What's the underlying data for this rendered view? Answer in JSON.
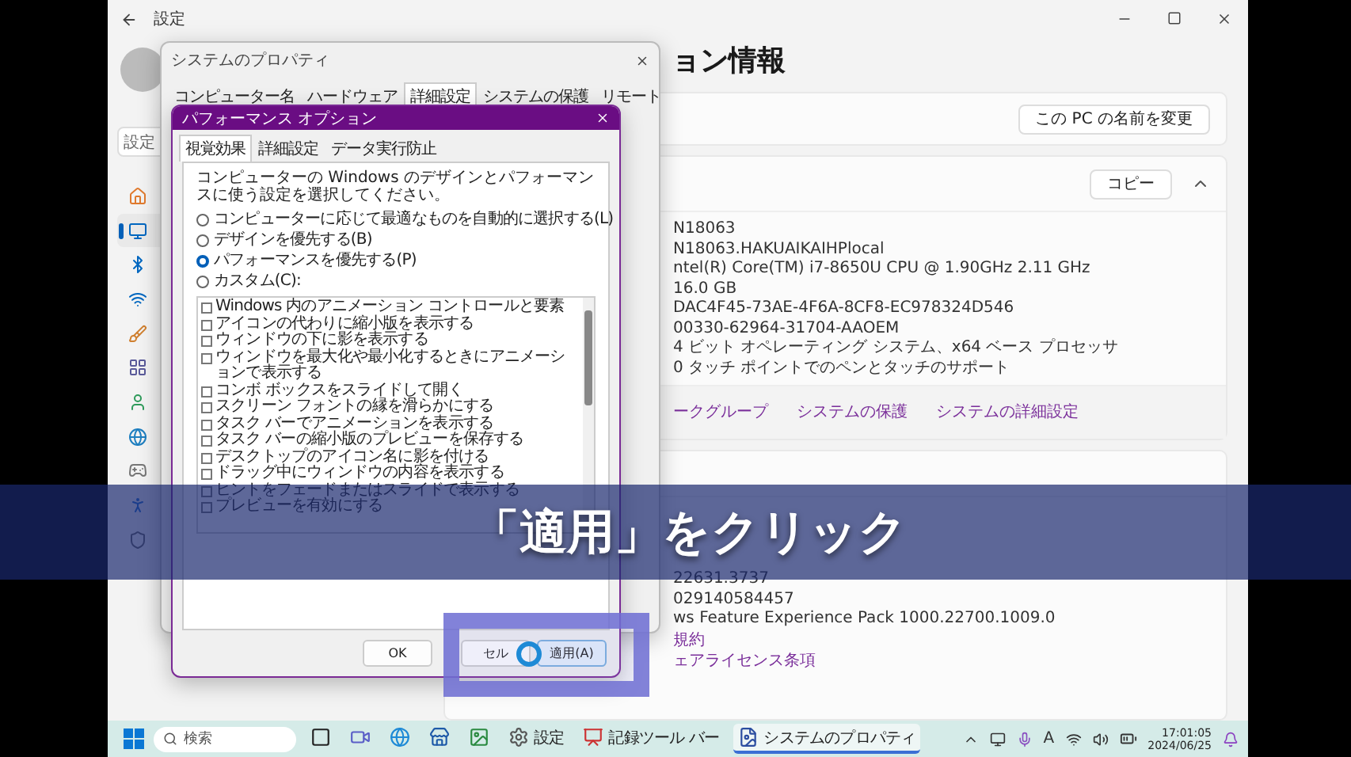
{
  "settings": {
    "title": "設定",
    "search_placeholder": "設定",
    "page_title": "ョン情報",
    "rename_button": "この PC の名前を変更",
    "nav": [
      {
        "kind": "home",
        "selected": false
      },
      {
        "kind": "system",
        "selected": true
      },
      {
        "kind": "bluetooth",
        "selected": false
      },
      {
        "kind": "network",
        "selected": false
      },
      {
        "kind": "personalization",
        "selected": false
      },
      {
        "kind": "apps",
        "selected": false
      },
      {
        "kind": "accounts",
        "selected": false
      },
      {
        "kind": "time",
        "selected": false
      },
      {
        "kind": "gaming",
        "selected": false
      },
      {
        "kind": "accessibility",
        "selected": false
      },
      {
        "kind": "privacy",
        "selected": false
      }
    ],
    "device_specs": {
      "copy_button": "コピー",
      "expanded": true,
      "values": [
        "N18063",
        "N18063.HAKUAIKAIHPlocal",
        "ntel(R) Core(TM) i7-8650U CPU @ 1.90GHz   2.11 GHz",
        "16.0 GB",
        "DAC4F45-73AE-4F6A-8CF8-EC978324D546",
        "00330-62964-31704-AAOEM",
        "4 ビット オペレーティング システム、x64 ベース プロセッサ",
        "0 タッチ ポイントでのペンとタッチのサポート"
      ],
      "links": [
        "ークグループ",
        "システムの保護",
        "システムの詳細設定"
      ]
    },
    "windows_specs": {
      "values": [
        "22631.3737",
        "029140584457",
        "ws Feature Experience Pack 1000.22700.1009.0"
      ],
      "links": [
        "規約",
        "ェアライセンス条項"
      ]
    }
  },
  "system_properties": {
    "title": "システムのプロパティ",
    "tabs": [
      {
        "label": "コンピューター名",
        "selected": false
      },
      {
        "label": "ハードウェア",
        "selected": false
      },
      {
        "label": "詳細設定",
        "selected": true
      },
      {
        "label": "システムの保護",
        "selected": false
      },
      {
        "label": "リモート",
        "selected": false
      }
    ]
  },
  "performance_options": {
    "title": "パフォーマンス オプション",
    "tabs": [
      {
        "label": "視覚効果",
        "selected": true
      },
      {
        "label": "詳細設定",
        "selected": false
      },
      {
        "label": "データ実行防止",
        "selected": false
      }
    ],
    "description": "コンピューターの Windows のデザインとパフォーマンスに使う設定を選択してください。",
    "options": [
      {
        "label": "コンピューターに応じて最適なものを自動的に選択する(L)",
        "selected": false
      },
      {
        "label": "デザインを優先する(B)",
        "selected": false
      },
      {
        "label": "パフォーマンスを優先する(P)",
        "selected": true
      },
      {
        "label": "カスタム(C):",
        "selected": false
      }
    ],
    "effects": [
      {
        "label": "Windows 内のアニメーション コントロールと要素",
        "checked": false
      },
      {
        "label": "アイコンの代わりに縮小版を表示する",
        "checked": false
      },
      {
        "label": "ウィンドウの下に影を表示する",
        "checked": false
      },
      {
        "label": "ウィンドウを最大化や最小化するときにアニメーションで表示する",
        "checked": false
      },
      {
        "label": "コンボ ボックスをスライドして開く",
        "checked": false
      },
      {
        "label": "スクリーン フォントの縁を滑らかにする",
        "checked": false
      },
      {
        "label": "タスク バーでアニメーションを表示する",
        "checked": false
      },
      {
        "label": "タスク バーの縮小版のプレビューを保存する",
        "checked": false
      },
      {
        "label": "デスクトップのアイコン名に影を付ける",
        "checked": false
      },
      {
        "label": "ドラッグ中にウィンドウの内容を表示する",
        "checked": false
      },
      {
        "label": "ヒントをフェードまたはスライドで表示する",
        "checked": false
      },
      {
        "label": "プレビューを有効にする",
        "checked": false
      }
    ],
    "buttons": [
      "OK",
      "セル",
      "適用(A)"
    ]
  },
  "caption": "「適用」をクリック",
  "taskbar": {
    "search_placeholder": "検索",
    "apps": [
      {
        "kind": "taskview",
        "active": false
      },
      {
        "kind": "teams",
        "active": false
      },
      {
        "kind": "edge",
        "active": false
      },
      {
        "kind": "store",
        "active": false
      },
      {
        "kind": "viewer",
        "active": false
      },
      {
        "kind": "settings",
        "label": "設定",
        "active": false
      },
      {
        "kind": "recorder",
        "label": "記録ツール バー",
        "active": false
      },
      {
        "kind": "properties",
        "label": "システムのプロパティ",
        "active": true
      }
    ],
    "ime": "A",
    "time": "17:01:05",
    "date": "2024/06/25"
  }
}
